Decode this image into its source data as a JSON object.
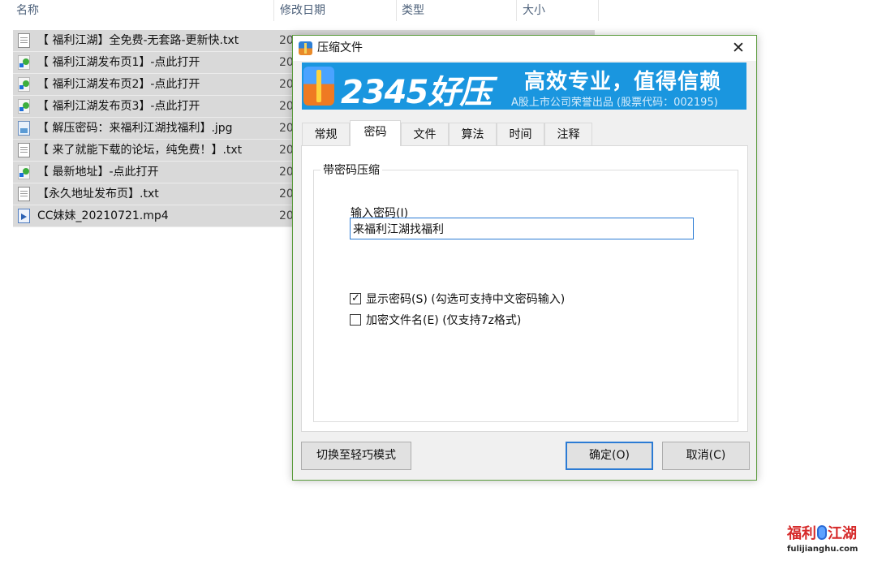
{
  "explorer": {
    "columns": {
      "name": "名称",
      "modified": "修改日期",
      "type": "类型",
      "size": "大小"
    },
    "sort_caret": "^",
    "files": [
      {
        "name": "【 福利江湖】全免费-无套路-更新快.txt",
        "date": "20",
        "icon": "text-file-icon"
      },
      {
        "name": "【 福利江湖发布页1】-点此打开",
        "date": "20",
        "icon": "internet-shortcut-icon"
      },
      {
        "name": "【 福利江湖发布页2】-点此打开",
        "date": "20",
        "icon": "internet-shortcut-icon"
      },
      {
        "name": "【 福利江湖发布页3】-点此打开",
        "date": "20",
        "icon": "internet-shortcut-icon"
      },
      {
        "name": "【 解压密码：来福利江湖找福利】.jpg",
        "date": "20",
        "icon": "image-file-icon"
      },
      {
        "name": "【 来了就能下载的论坛，纯免费！】.txt",
        "date": "20",
        "icon": "text-file-icon"
      },
      {
        "name": "【 最新地址】-点此打开",
        "date": "20",
        "icon": "internet-shortcut-icon"
      },
      {
        "name": "【永久地址发布页】.txt",
        "date": "20",
        "icon": "text-file-icon"
      },
      {
        "name": "CC妹妹_20210721.mp4",
        "date": "20",
        "icon": "video-file-icon"
      }
    ]
  },
  "dialog": {
    "title": "压缩文件",
    "close": "✕",
    "banner": {
      "brand": "2345好压",
      "slogan": "高效专业，值得信赖",
      "sub": "A股上市公司荣誉出品 (股票代码：002195)"
    },
    "tabs": [
      "常规",
      "密码",
      "文件",
      "算法",
      "时间",
      "注释"
    ],
    "active_tab": "密码",
    "group_title": "带密码压缩",
    "password_label": "输入密码(I)",
    "password_value": "来福利江湖找福利",
    "show_password": {
      "label": "显示密码(S) (勾选可支持中文密码输入)",
      "checked": true
    },
    "encrypt_filenames": {
      "label": "加密文件名(E) (仅支持7z格式)",
      "checked": false
    },
    "buttons": {
      "switch_mode": "切换至轻巧模式",
      "ok": "确定(O)",
      "cancel": "取消(C)"
    }
  },
  "watermark": {
    "logo_left": "福利",
    "logo_right": "江湖",
    "url": "fulijianghu.com"
  },
  "colors": {
    "banner": "#1a96df",
    "selection": "#d9d9d9",
    "accent": "#2b7bd4",
    "dialog_border": "#5a9b3c"
  }
}
